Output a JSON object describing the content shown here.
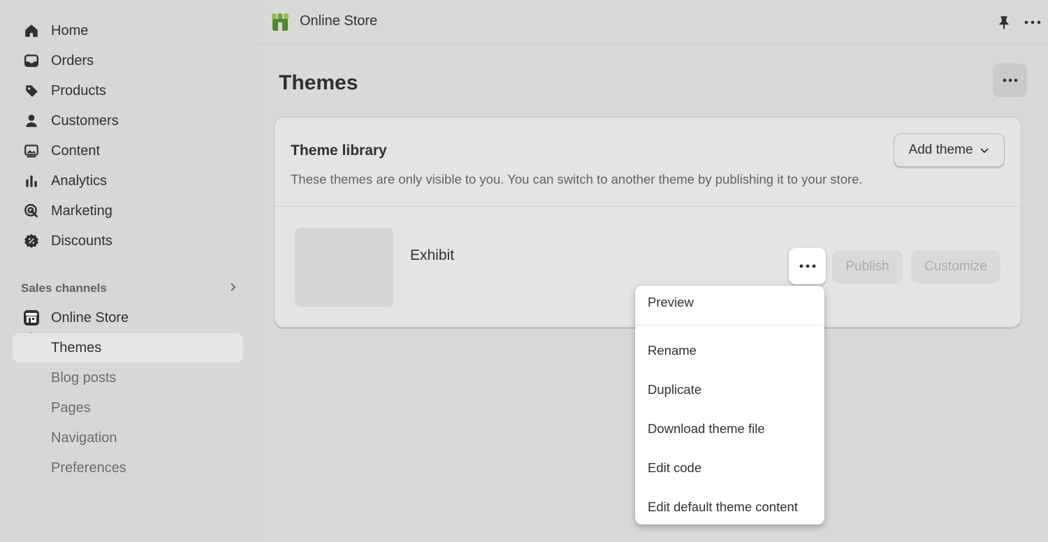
{
  "sidebar": {
    "items": [
      {
        "label": "Home",
        "icon": "home-icon"
      },
      {
        "label": "Orders",
        "icon": "inbox-icon"
      },
      {
        "label": "Products",
        "icon": "tag-icon"
      },
      {
        "label": "Customers",
        "icon": "person-icon"
      },
      {
        "label": "Content",
        "icon": "image-icon"
      },
      {
        "label": "Analytics",
        "icon": "bar-chart-icon"
      },
      {
        "label": "Marketing",
        "icon": "target-icon"
      },
      {
        "label": "Discounts",
        "icon": "discount-icon"
      }
    ],
    "sales_channels_title": "Sales channels",
    "online_store": {
      "label": "Online Store",
      "icon": "storefront-icon"
    },
    "sub_items": [
      {
        "label": "Themes",
        "active": true
      },
      {
        "label": "Blog posts"
      },
      {
        "label": "Pages"
      },
      {
        "label": "Navigation"
      },
      {
        "label": "Preferences"
      }
    ]
  },
  "topbar": {
    "title": "Online Store"
  },
  "page": {
    "title": "Themes"
  },
  "theme_library": {
    "title": "Theme library",
    "description": "These themes are only visible to you. You can switch to another theme by publishing it to your store.",
    "add_theme_label": "Add theme",
    "theme": {
      "name": "Exhibit",
      "publish_label": "Publish",
      "customize_label": "Customize"
    }
  },
  "menu": {
    "items": [
      "Preview",
      "Rename",
      "Duplicate",
      "Download theme file",
      "Edit code",
      "Edit default theme content"
    ]
  },
  "colors": {
    "background": "#d9d9d9",
    "card": "#e4e4e4",
    "text": "#303030",
    "muted_text": "#616161",
    "brand_green": "#95bf47"
  }
}
